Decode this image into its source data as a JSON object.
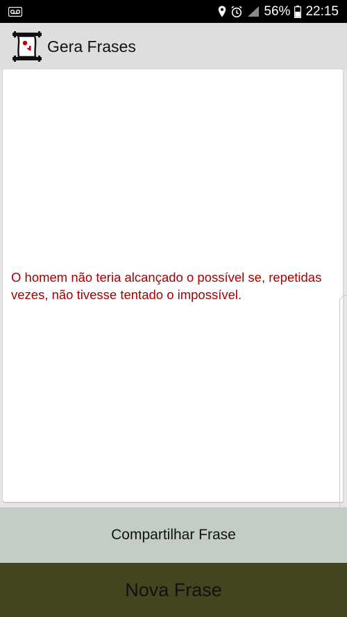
{
  "status_bar": {
    "battery_percent": "56%",
    "time": "22:15",
    "icons": [
      "voicemail-icon",
      "location-icon",
      "alarm-icon",
      "signal-icon",
      "battery-icon"
    ]
  },
  "app_bar": {
    "title": "Gera Frases",
    "logo_icon": "scroll-icon"
  },
  "content": {
    "quote": "O homem não teria alcançado o possível se, repetidas vezes, não tivesse tentado o impossível."
  },
  "buttons": {
    "share_label": "Compartilhar Frase",
    "new_label": "Nova Frase"
  },
  "colors": {
    "quote_text": "#a30000",
    "share_button_bg": "#c3cdc3",
    "new_button_bg": "#44441f",
    "app_bar_bg": "#dedede",
    "status_bar_bg": "#000000"
  }
}
